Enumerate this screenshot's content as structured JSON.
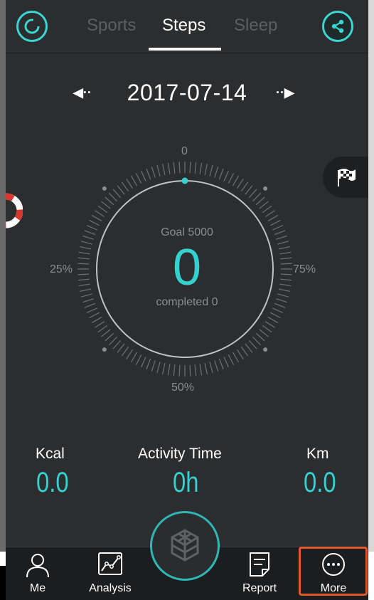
{
  "header": {
    "tabs": [
      {
        "label": "Sports",
        "active": false
      },
      {
        "label": "Steps",
        "active": true
      },
      {
        "label": "Sleep",
        "active": false
      }
    ],
    "left_icon": "refresh-icon",
    "right_icon": "share-icon",
    "accent_color": "#3ad6d2"
  },
  "date": {
    "value": "2017-07-14",
    "prev_icon": "arrow-left-icon",
    "next_icon": "arrow-right-icon"
  },
  "dial": {
    "top_label": "0",
    "left_label": "25%",
    "right_label": "75%",
    "bottom_label": "50%",
    "goal_text": "Goal 5000",
    "steps_value": "0",
    "completed_text": "completed 0",
    "progress_fraction": 0
  },
  "stats": [
    {
      "label": "Kcal",
      "value": "0.0"
    },
    {
      "label": "Activity Time",
      "value": "0h"
    },
    {
      "label": "Km",
      "value": "0.0"
    }
  ],
  "nav": {
    "items": [
      {
        "label": "Me",
        "icon": "person-icon"
      },
      {
        "label": "Analysis",
        "icon": "chart-icon"
      },
      {
        "label": "Report",
        "icon": "report-icon"
      },
      {
        "label": "More",
        "icon": "more-icon"
      }
    ],
    "center_icon": "cube-logo-icon",
    "highlight_color": "#e3582b"
  }
}
